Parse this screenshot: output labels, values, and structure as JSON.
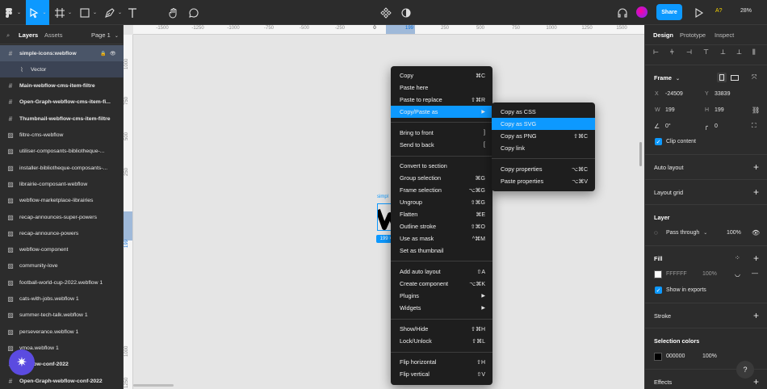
{
  "toolbar": {
    "zoom": "28%",
    "share_label": "Share",
    "user_initials": "A?"
  },
  "left_panel": {
    "tabs": {
      "layers": "Layers",
      "assets": "Assets"
    },
    "page_selector": "Page 1",
    "layers": [
      {
        "label": "simple-icons:webflow",
        "icon": "frame-icon"
      },
      {
        "label": "Vector",
        "icon": "vector-icon"
      },
      {
        "label": "Main-webflow-cms-item-filtre",
        "icon": "frame-icon"
      },
      {
        "label": "Open-Graph-webflow-cms-item-fi...",
        "icon": "frame-icon"
      },
      {
        "label": "Thumbnail-webflow-cms-item-filtre",
        "icon": "frame-icon"
      },
      {
        "label": "filtre-cms-webflow",
        "icon": "image-icon"
      },
      {
        "label": "utiliser-composants-bibliotheque-...",
        "icon": "image-icon"
      },
      {
        "label": "installer-bibliotheque-composants-...",
        "icon": "image-icon"
      },
      {
        "label": "librairie-composant-webflow",
        "icon": "image-icon"
      },
      {
        "label": "webflow-marketplace-librairies",
        "icon": "image-icon"
      },
      {
        "label": "recap-announces-super-powers",
        "icon": "image-icon"
      },
      {
        "label": "recap-announce-powers",
        "icon": "image-icon"
      },
      {
        "label": "webflow-component",
        "icon": "image-icon"
      },
      {
        "label": "community-love",
        "icon": "image-icon"
      },
      {
        "label": "football-world-cup-2022.webflow 1",
        "icon": "image-icon"
      },
      {
        "label": "cats-with-jobs.webflow 1",
        "icon": "image-icon"
      },
      {
        "label": "summer-tech-talk.webflow 1",
        "icon": "image-icon"
      },
      {
        "label": "perseverance.webflow 1",
        "icon": "image-icon"
      },
      {
        "label": "vmoa.webflow 1",
        "icon": "image-icon"
      },
      {
        "label": "webflow-conf-2022",
        "icon": "frame-icon"
      },
      {
        "label": "Open-Graph-webflow-conf-2022",
        "icon": "frame-icon"
      }
    ]
  },
  "canvas": {
    "hruler": [
      "-1500",
      "-1250",
      "-1000",
      "-750",
      "-500",
      "-250",
      "0",
      "199",
      "250",
      "500",
      "750",
      "1000",
      "1250",
      "1500"
    ],
    "vruler": [
      "1000",
      "750",
      "500",
      "250",
      "199",
      "1000",
      "1250"
    ],
    "frame_label": "simpl",
    "size_badge": "199 × 199"
  },
  "context_menu": {
    "items": [
      {
        "label": "Copy",
        "shortcut": "⌘C"
      },
      {
        "label": "Paste here",
        "shortcut": ""
      },
      {
        "label": "Paste to replace",
        "shortcut": "⇧⌘R"
      },
      {
        "label": "Copy/Paste as",
        "shortcut": "▶"
      },
      {
        "label": "Bring to front",
        "shortcut": "]"
      },
      {
        "label": "Send to back",
        "shortcut": "["
      },
      {
        "label": "Convert to section",
        "shortcut": ""
      },
      {
        "label": "Group selection",
        "shortcut": "⌘G"
      },
      {
        "label": "Frame selection",
        "shortcut": "⌥⌘G"
      },
      {
        "label": "Ungroup",
        "shortcut": "⇧⌘G"
      },
      {
        "label": "Flatten",
        "shortcut": "⌘E"
      },
      {
        "label": "Outline stroke",
        "shortcut": "⇧⌘O"
      },
      {
        "label": "Use as mask",
        "shortcut": "^⌘M"
      },
      {
        "label": "Set as thumbnail",
        "shortcut": ""
      },
      {
        "label": "Add auto layout",
        "shortcut": "⇧A"
      },
      {
        "label": "Create component",
        "shortcut": "⌥⌘K"
      },
      {
        "label": "Plugins",
        "shortcut": "▶"
      },
      {
        "label": "Widgets",
        "shortcut": "▶"
      },
      {
        "label": "Show/Hide",
        "shortcut": "⇧⌘H"
      },
      {
        "label": "Lock/Unlock",
        "shortcut": "⇧⌘L"
      },
      {
        "label": "Flip horizontal",
        "shortcut": "⇧H"
      },
      {
        "label": "Flip vertical",
        "shortcut": "⇧V"
      }
    ]
  },
  "sub_menu": {
    "items": [
      {
        "label": "Copy as CSS",
        "shortcut": ""
      },
      {
        "label": "Copy as SVG",
        "shortcut": ""
      },
      {
        "label": "Copy as PNG",
        "shortcut": "⇧⌘C"
      },
      {
        "label": "Copy link",
        "shortcut": ""
      },
      {
        "label": "Copy properties",
        "shortcut": "⌥⌘C"
      },
      {
        "label": "Paste properties",
        "shortcut": "⌥⌘V"
      }
    ]
  },
  "right_panel": {
    "tabs": {
      "design": "Design",
      "prototype": "Prototype",
      "inspect": "Inspect"
    },
    "frame_title": "Frame",
    "x": "-24509",
    "y": "33839",
    "w": "199",
    "h": "199",
    "rotation": "0°",
    "radius": "0",
    "clip_content": "Clip content",
    "auto_layout": "Auto layout",
    "layout_grid": "Layout grid",
    "layer_title": "Layer",
    "blend_mode": "Pass through",
    "layer_opacity": "100%",
    "fill_title": "Fill",
    "fill_hex": "FFFFFF",
    "fill_opacity": "100%",
    "show_in_exports": "Show in exports",
    "stroke_title": "Stroke",
    "selection_colors_title": "Selection colors",
    "sel_color_hex": "000000",
    "sel_color_opacity": "100%",
    "effects_title": "Effects",
    "help": "?"
  }
}
